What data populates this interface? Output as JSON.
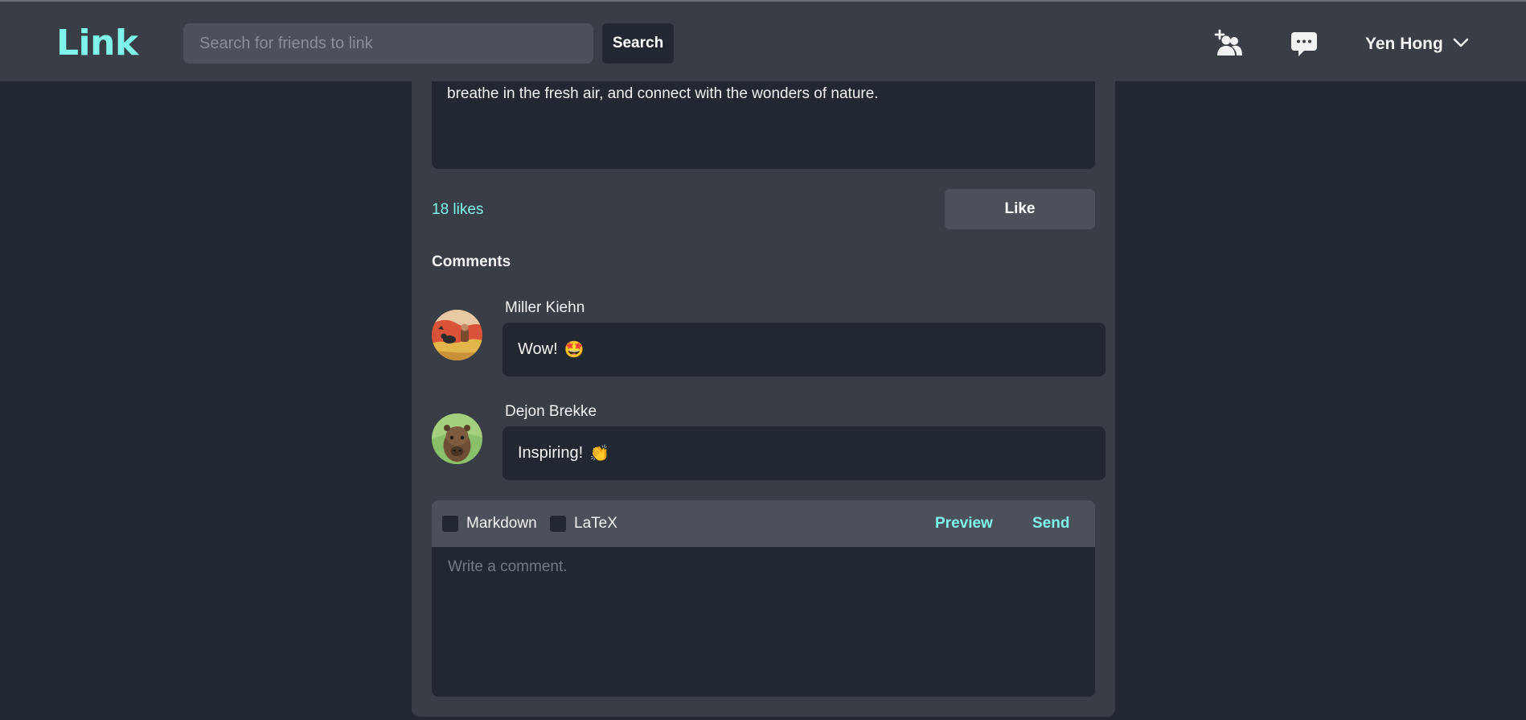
{
  "navbar": {
    "brand": "Link",
    "search_placeholder": "Search for friends to link",
    "search_button": "Search",
    "user_name": "Yen Hong"
  },
  "post": {
    "body_text": "breathe in the fresh air, and connect with the wonders of nature.",
    "likes_label": "18 likes",
    "like_button": "Like"
  },
  "comments": {
    "heading": "Comments",
    "items": [
      {
        "author": "Miller Kiehn",
        "text": "Wow!",
        "emoji": "🤩"
      },
      {
        "author": "Dejon Brekke",
        "text": "Inspiring!",
        "emoji": "👏"
      }
    ]
  },
  "editor": {
    "markdown_label": "Markdown",
    "latex_label": "LaTeX",
    "preview_label": "Preview",
    "send_label": "Send",
    "placeholder": "Write a comment."
  },
  "colors": {
    "accent": "#7ff5ea",
    "navbar": "#393e46",
    "background": "#222831",
    "card": "#393e46",
    "control": "#4b505a"
  }
}
